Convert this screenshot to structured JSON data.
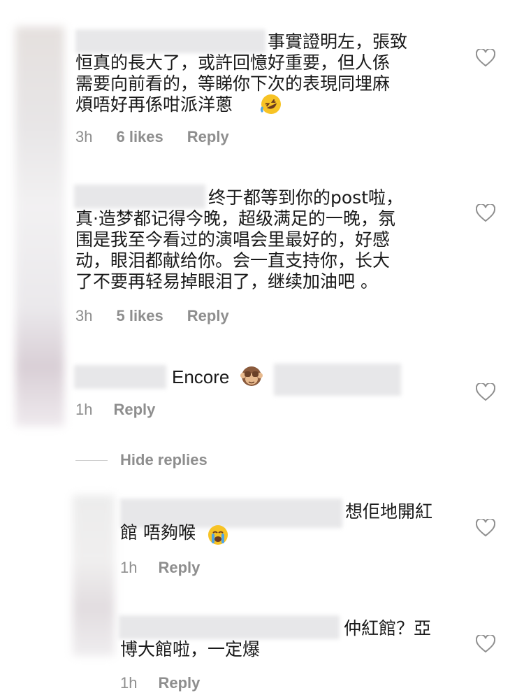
{
  "comments": [
    {
      "text": "事實證明左，張致\n恒真的長大了，或許回憶好重要，但人係\n需要向前看的，等睇你下次的表現同埋麻\n煩唔好再係咁派洋蔥",
      "emoji": "rofl",
      "time": "3h",
      "likes": "6 likes",
      "reply": "Reply"
    },
    {
      "text": "终于都等到你的post啦，\n真·造梦都记得今晚，超级满足的一晚，氛\n围是我至今看过的演唱会里最好的，好感\n动，眼泪都献给你。会一直支持你，长大\n了不要再轻易掉眼泪了，继续加油吧 。",
      "time": "3h",
      "likes": "5 likes",
      "reply": "Reply"
    },
    {
      "text": "Encore",
      "emoji": "see-no-evil-monkey",
      "time": "1h",
      "reply": "Reply"
    }
  ],
  "hide_replies": "Hide replies",
  "replies": [
    {
      "text": "想佢地開紅\n館 唔夠喉",
      "emoji": "crying",
      "time": "1h",
      "reply": "Reply"
    },
    {
      "text": "仲紅館？亞\n博大館啦，一定爆",
      "time": "1h",
      "reply": "Reply"
    }
  ],
  "icons": {
    "like": "heart-outline-icon"
  },
  "colors": {
    "text": "#1a1a1a",
    "meta": "#8e8e8e",
    "redaction": "#e7e7e9"
  }
}
